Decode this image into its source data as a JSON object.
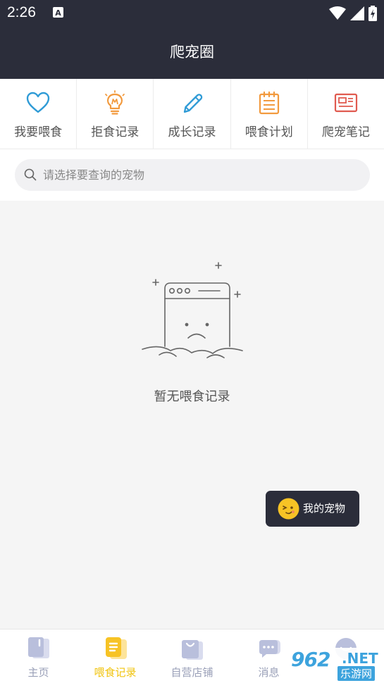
{
  "status_bar": {
    "time": "2:26",
    "a_icon": "A"
  },
  "header": {
    "title": "爬宠圈"
  },
  "quick_nav": [
    {
      "label": "我要喂食",
      "icon": "heart-icon",
      "color": "#2f9bd6"
    },
    {
      "label": "拒食记录",
      "icon": "lightbulb-icon",
      "color": "#f29a3e"
    },
    {
      "label": "成长记录",
      "icon": "pencil-icon",
      "color": "#2f9bd6"
    },
    {
      "label": "喂食计划",
      "icon": "notepad-icon",
      "color": "#f29a3e"
    },
    {
      "label": "爬宠笔记",
      "icon": "card-icon",
      "color": "#e05a4f"
    }
  ],
  "search": {
    "placeholder": "请选择要查询的宠物",
    "value": ""
  },
  "empty_state": {
    "message": "暂无喂食记录"
  },
  "floating_button": {
    "label": "我的宠物",
    "icon": "pet-face-icon"
  },
  "tab_bar": {
    "active_index": 1,
    "active_color": "#f1c40f",
    "tabs": [
      {
        "label": "主页",
        "icon": "home-icon"
      },
      {
        "label": "喂食记录",
        "icon": "record-icon"
      },
      {
        "label": "自营店铺",
        "icon": "shop-bag-icon"
      },
      {
        "label": "消息",
        "icon": "chat-icon"
      },
      {
        "label": "",
        "icon": "profile-icon"
      }
    ]
  },
  "watermark": {
    "logo": "962",
    "net": ".NET",
    "sub": "乐游网"
  }
}
